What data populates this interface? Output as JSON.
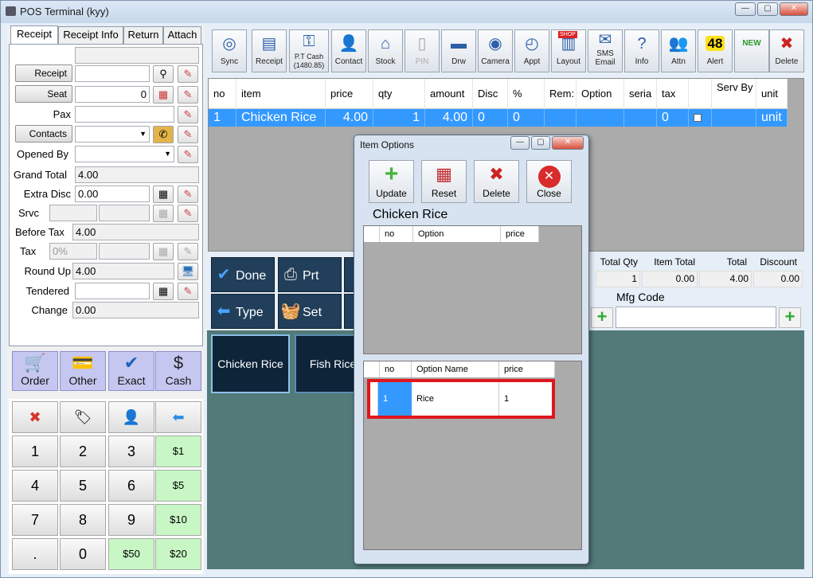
{
  "window": {
    "title": "POS Terminal (kyy)",
    "btn_min": "—",
    "btn_max": "▢",
    "btn_close": "✕"
  },
  "tabs": [
    "Receipt",
    "Receipt Info",
    "Return",
    "Attach"
  ],
  "left": {
    "receipt_btn": "Receipt",
    "seat_btn": "Seat",
    "seat_value": "0",
    "pax_label": "Pax",
    "contacts_btn": "Contacts",
    "opened_by_label": "Opened By",
    "grand_total_label": "Grand Total",
    "grand_total": "4.00",
    "extra_disc_label": "Extra Disc",
    "extra_disc": "0.00",
    "srvc_label": "Srvc",
    "before_tax_label": "Before Tax",
    "before_tax": "4.00",
    "tax_label": "Tax",
    "tax_placeholder": "0%",
    "round_up_label": "Round Up",
    "round_up": "4.00",
    "tendered_label": "Tendered",
    "change_label": "Change",
    "change": "0.00"
  },
  "payment_buttons": [
    {
      "label": "Order",
      "icon": "cart-icon"
    },
    {
      "label": "Other",
      "icon": "card-icon"
    },
    {
      "label": "Exact",
      "icon": "check-icon"
    },
    {
      "label": "Cash",
      "icon": "dollar-icon"
    }
  ],
  "keypad": {
    "top": [
      "✖",
      "🏷",
      "👤",
      "⬅"
    ],
    "rows": [
      [
        "1",
        "2",
        "3",
        "$1"
      ],
      [
        "4",
        "5",
        "6",
        "$5"
      ],
      [
        "7",
        "8",
        "9",
        "$10"
      ],
      [
        ".",
        "0",
        "$50",
        "$20"
      ]
    ]
  },
  "toolbar": [
    {
      "label": "Sync",
      "icon": "sync-icon"
    },
    {
      "label": "Receipt",
      "icon": "receipt-icon"
    },
    {
      "label": "P.T Cash\n(1480.85)",
      "icon": "key-icon"
    },
    {
      "label": "Contact",
      "icon": "contact-icon"
    },
    {
      "label": "Stock",
      "icon": "house-icon"
    },
    {
      "label": "PIN",
      "icon": "phone-icon"
    },
    {
      "label": "Drw",
      "icon": "drawer-icon"
    },
    {
      "label": "Camera",
      "icon": "camera-icon"
    },
    {
      "label": "Appt",
      "icon": "clock-icon"
    },
    {
      "label": "Layout",
      "icon": "shop-icon"
    },
    {
      "label": "SMS\nEmail",
      "icon": "email-icon"
    },
    {
      "label": "Info",
      "icon": "info-icon"
    },
    {
      "label": "Attn",
      "icon": "people-icon"
    },
    {
      "label": "Alert",
      "icon": "alert-icon"
    },
    {
      "label": "",
      "icon": "new-icon"
    },
    {
      "label": "Delete",
      "icon": "delete-icon"
    }
  ],
  "alert_count": "48",
  "new_badge": "NEW",
  "shop_badge": "SHOP",
  "grid": {
    "columns": [
      "no",
      "item",
      "price",
      "qty",
      "amount",
      "Disc",
      "%",
      "Rem:",
      "Option",
      "seria",
      "tax",
      "",
      "Serv By",
      "unit"
    ],
    "row": [
      "1",
      "Chicken Rice",
      "4.00",
      "1",
      "4.00",
      "0",
      "0",
      "",
      "",
      "",
      "0",
      "",
      "",
      "unit"
    ]
  },
  "summary": {
    "total_qty_label": "Total Qty",
    "total_qty": "1",
    "item_total_label": "Item Total",
    "item_total": "0.00",
    "total_label": "Total",
    "total": "4.00",
    "discount_label": "Discount",
    "discount": "0.00",
    "mfg_label": "Mfg Code"
  },
  "action_buttons": [
    {
      "label": "Done",
      "icon": "check-icon"
    },
    {
      "label": "Prt Full",
      "icon": "printer-icon"
    },
    {
      "label": "Type",
      "icon": "arrow-left-icon"
    },
    {
      "label": "Set",
      "icon": "basket-icon"
    }
  ],
  "categories": [
    "Chicken Rice",
    "Fish Rice"
  ],
  "dialog": {
    "title": "Item Options",
    "buttons": [
      {
        "label": "Update",
        "icon": "plus-icon"
      },
      {
        "label": "Reset",
        "icon": "reset-icon"
      },
      {
        "label": "Delete",
        "icon": "delete-icon"
      },
      {
        "label": "Close",
        "icon": "close-icon"
      }
    ],
    "item_name": "Chicken Rice",
    "top_grid": {
      "columns": [
        "no",
        "Option",
        "price"
      ]
    },
    "bottom_grid": {
      "columns": [
        "no",
        "Option Name",
        "price"
      ],
      "rows": [
        [
          "1",
          "Rice",
          "1"
        ]
      ]
    }
  },
  "colors": {
    "selection": "#3399ff",
    "highlight": "#e0161e",
    "category_bg": "#527a78"
  }
}
